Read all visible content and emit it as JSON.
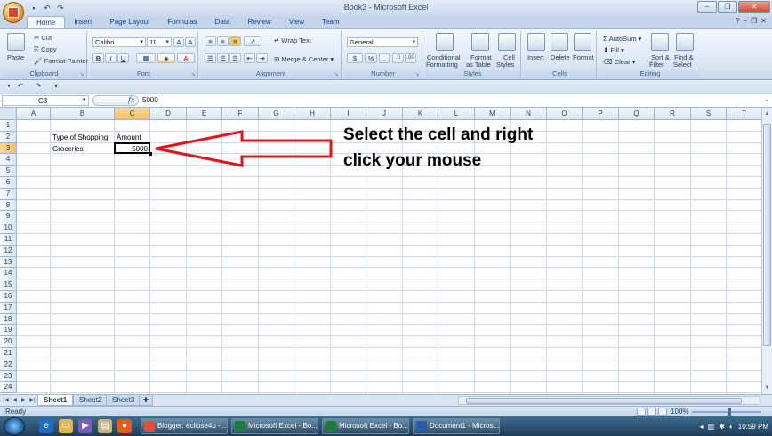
{
  "window": {
    "title": "Book3 - Microsoft Excel"
  },
  "ribbon": {
    "tabs": [
      "Home",
      "Insert",
      "Page Layout",
      "Formulas",
      "Data",
      "Review",
      "View",
      "Team"
    ],
    "clipboard": {
      "paste": "Paste",
      "cut": "Cut",
      "copy": "Copy",
      "format_painter": "Format Painter",
      "label": "Clipboard"
    },
    "font": {
      "name": "Calibri",
      "size": "11",
      "bold": "B",
      "italic": "I",
      "underline": "U",
      "label": "Font"
    },
    "alignment": {
      "wrap_text": "Wrap Text",
      "merge_center": "Merge & Center",
      "label": "Alignment"
    },
    "number": {
      "format": "General",
      "currency": "$",
      "percent": "%",
      "comma": ",",
      "label": "Number"
    },
    "styles": {
      "conditional": "Conditional",
      "conditional2": "Formatting",
      "format_as": "Format",
      "format_as2": "as Table",
      "cell_styles": "Cell",
      "cell_styles2": "Styles",
      "label": "Styles"
    },
    "cells": {
      "insert": "Insert",
      "delete": "Delete",
      "format": "Format",
      "label": "Cells"
    },
    "editing": {
      "autosum": "AutoSum",
      "fill": "Fill",
      "clear": "Clear",
      "sort": "Sort &",
      "sort2": "Filter",
      "find": "Find &",
      "find2": "Select",
      "label": "Editing"
    }
  },
  "formula_bar": {
    "name_box": "C3",
    "fx": "fx",
    "value": "5000"
  },
  "grid": {
    "columns": [
      "A",
      "B",
      "C",
      "D",
      "E",
      "F",
      "G",
      "H",
      "I",
      "J",
      "K",
      "L",
      "M",
      "N",
      "O",
      "P",
      "Q",
      "R",
      "S",
      "T"
    ],
    "rows": [
      "1",
      "2",
      "3",
      "4",
      "5",
      "6",
      "7",
      "8",
      "9",
      "10",
      "11",
      "12",
      "13",
      "14",
      "15",
      "16",
      "17",
      "18",
      "19",
      "20",
      "21",
      "22",
      "23",
      "24"
    ],
    "cells": {
      "B2": "Type of Shopping",
      "C2": "Amount",
      "B3": "Groceries",
      "C3": "5000"
    },
    "selected_cell": "C3"
  },
  "annotation": {
    "line1": "Select the cell and right",
    "line2": "click your mouse",
    "arrow_color": "#e0161b"
  },
  "sheets": {
    "tabs": [
      "Sheet1",
      "Sheet2",
      "Sheet3"
    ],
    "active": "Sheet1"
  },
  "status": {
    "text": "Ready",
    "zoom": "100%"
  },
  "taskbar": {
    "items": [
      "Blogger: eclipse4u - ...",
      "Microsoft Excel - Bo...",
      "Microsoft Excel - Bo...",
      "Document1 - Micros..."
    ],
    "clock": "10:59 PM"
  }
}
